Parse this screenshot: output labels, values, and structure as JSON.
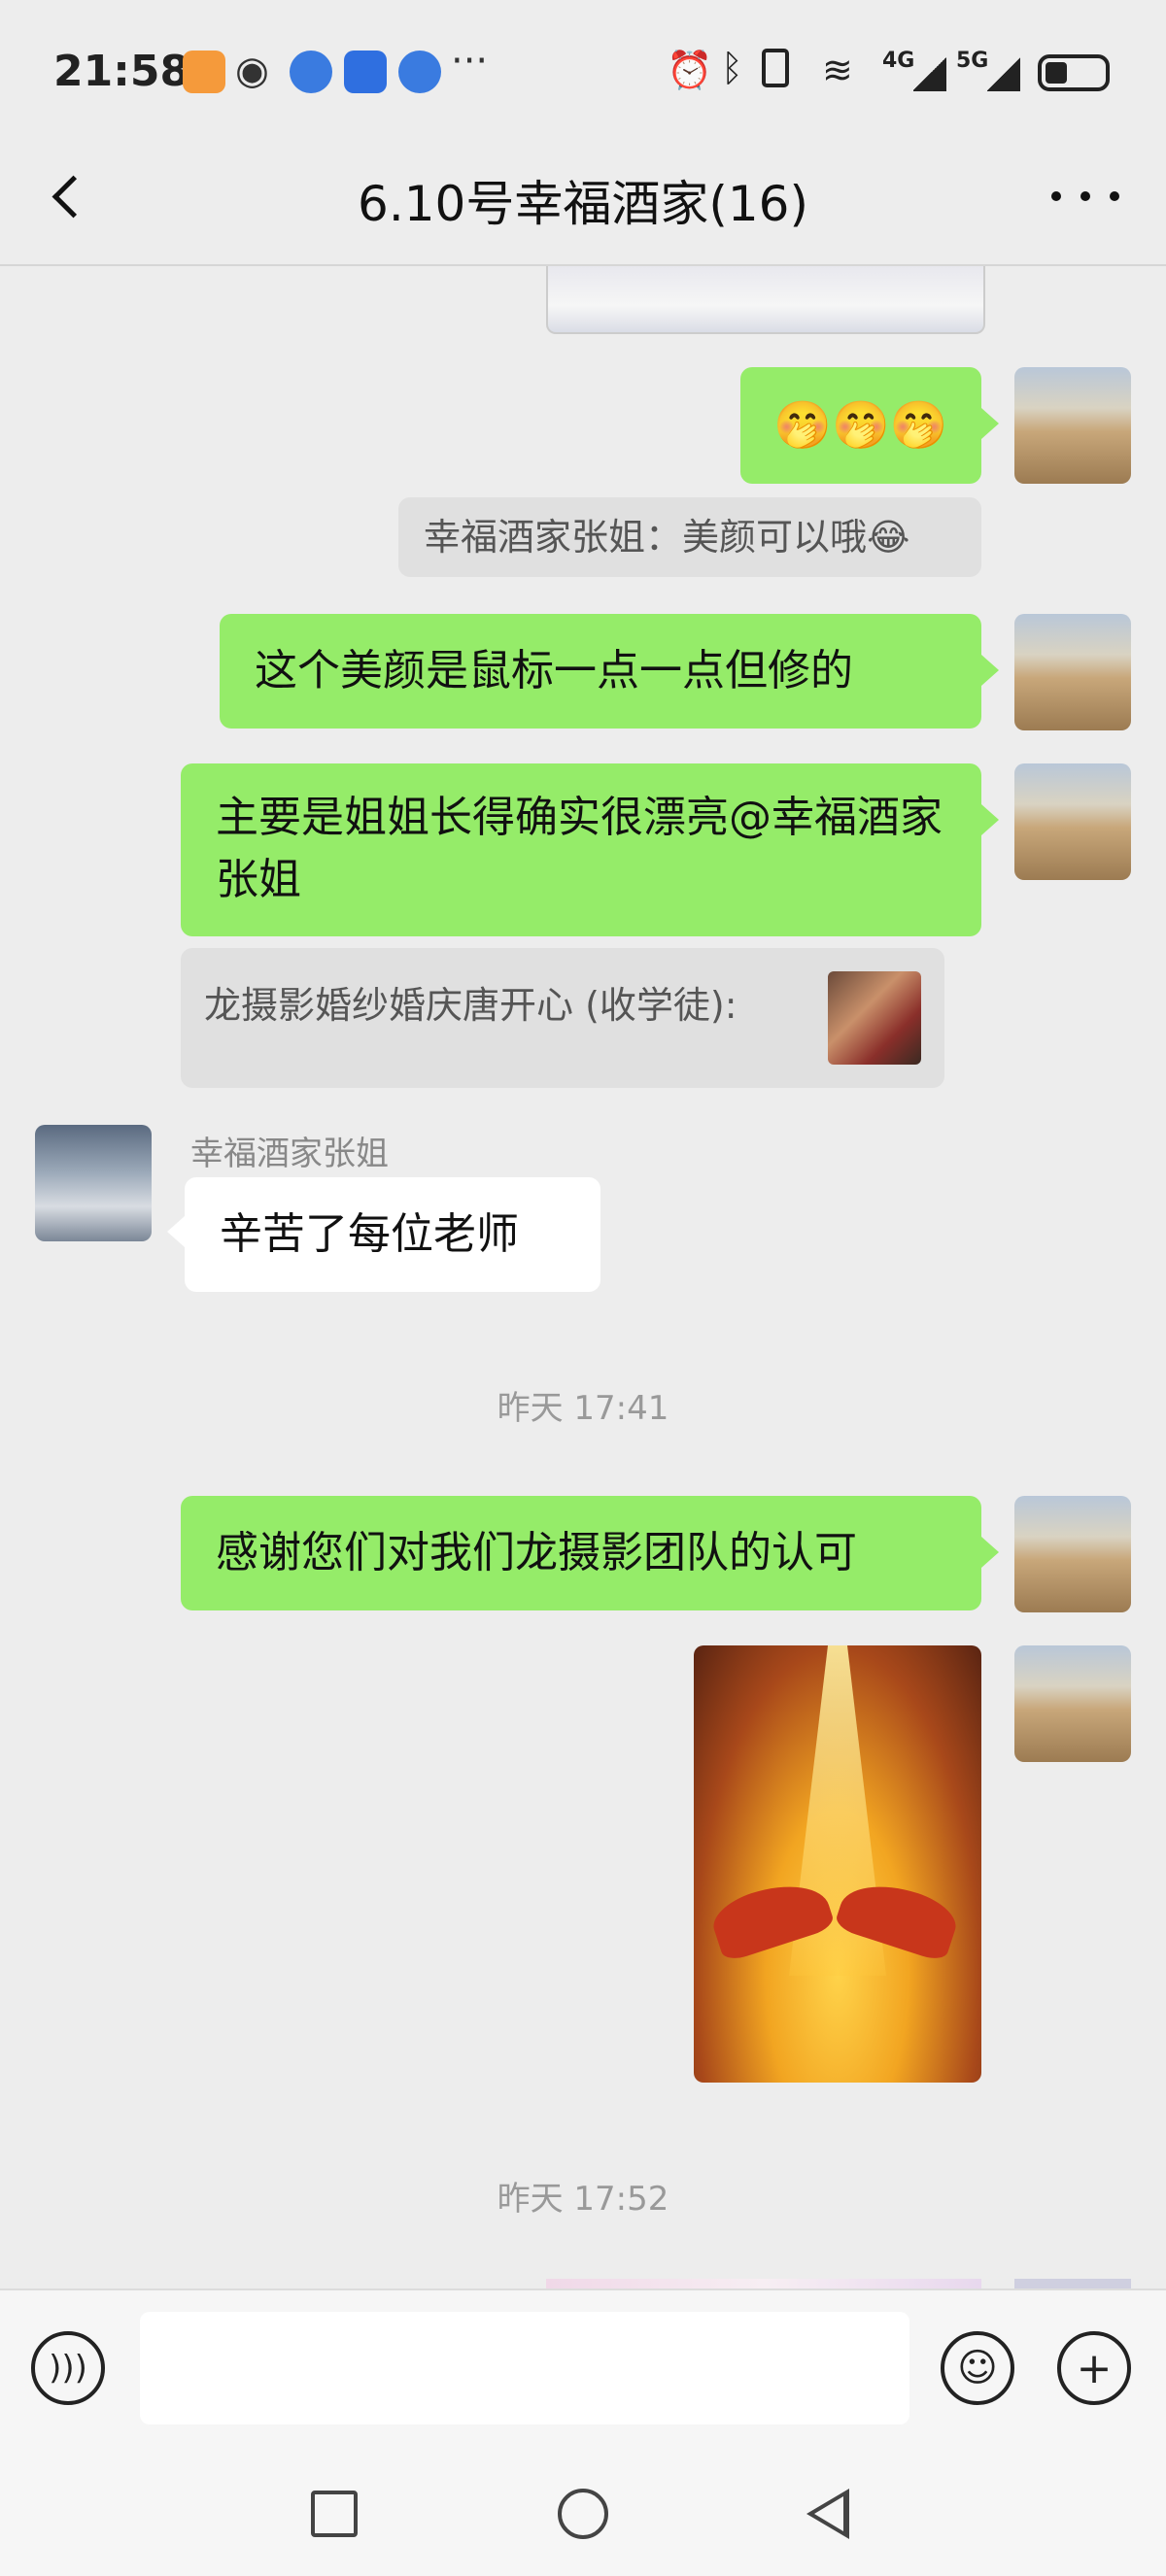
{
  "status_bar": {
    "time": "21:58",
    "signal_1": "4G",
    "signal_2": "5G",
    "more": "···"
  },
  "header": {
    "back_icon": "chevron-left-icon",
    "title": "6.10号幸福酒家(16)",
    "more_icon": "ellipsis-icon"
  },
  "messages": {
    "emoji_msg": "🤭🤭🤭",
    "system_note": "幸福酒家张姐：美颜可以哦😂",
    "msg_beauty": "这个美颜是鼠标一点一点但修的",
    "msg_pretty": "主要是姐姐长得确实很漂亮@幸福酒家张姐",
    "quote_text": "龙摄影婚纱婚庆唐开心 (收学徒):",
    "sender_name": "幸福酒家张姐",
    "msg_thanks_teachers": "辛苦了每位老师",
    "timestamp_1": "昨天 17:41",
    "msg_thanks_team": "感谢您们对我们龙摄影团队的认可",
    "timestamp_2": "昨天 17:52"
  },
  "input_bar": {
    "voice_icon": "voice-icon",
    "emoji_icon": "emoji-icon",
    "plus_icon": "plus-icon"
  },
  "colors": {
    "sent_bubble": "#95ec69",
    "received_bubble": "#ffffff",
    "background": "#ededed"
  }
}
